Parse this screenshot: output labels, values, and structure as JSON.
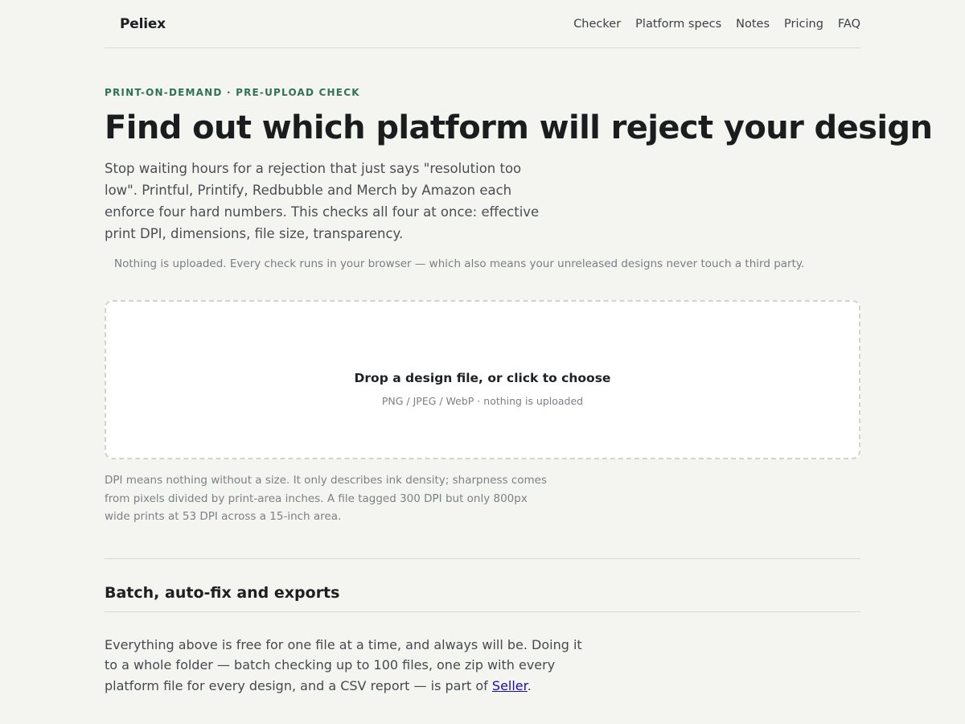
{
  "header": {
    "logo": "Peliex",
    "nav": [
      "Checker",
      "Platform specs",
      "Notes",
      "Pricing",
      "FAQ"
    ]
  },
  "hero": {
    "eyebrow": "PRINT-ON-DEMAND · PRE-UPLOAD CHECK",
    "title": "Find out which platform will reject your design",
    "lede": "Stop waiting hours for a rejection that just says \"resolution too low\". Printful, Printify, Redbubble and Merch by Amazon each enforce four hard numbers. This checks all four at once: effective print DPI, dimensions, file size, transparency.",
    "privacy": "Nothing is uploaded. Every check runs in your browser — which also means your unreleased designs never touch a third party."
  },
  "dropzone": {
    "title": "Drop a design file, or click to choose",
    "subtitle": "PNG / JPEG / WebP · nothing is uploaded"
  },
  "dpi_note": "DPI means nothing without a size. It only describes ink density; sharpness comes from pixels divided by print-area inches. A file tagged 300 DPI but only 800px wide prints at 53 DPI across a 15-inch area.",
  "batch": {
    "title": "Batch, auto-fix and exports",
    "body": "Everything above is free for one file at a time, and always will be. Doing it to a whole folder — batch checking up to 100 files, one zip with every platform file for every design, and a CSV report — is part of",
    "link": "Seller",
    "end": "."
  },
  "colors": {
    "background": "#f4f4f1",
    "accent": "#2f7357",
    "link": "#1a0dab"
  }
}
